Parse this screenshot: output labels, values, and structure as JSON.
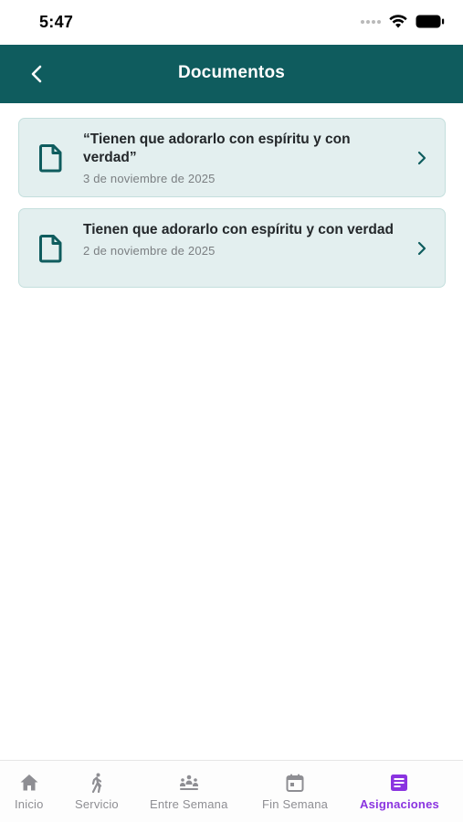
{
  "status_bar": {
    "time": "5:47"
  },
  "header": {
    "title": "Documentos"
  },
  "documents": [
    {
      "title": "“Tienen que adorarlo con espíritu y con verdad”",
      "date": "3 de noviembre de 2025"
    },
    {
      "title": "Tienen que adorarlo con espíritu y con verdad",
      "date": "2 de noviembre de 2025"
    }
  ],
  "tab_bar": {
    "active": "Asignaciones",
    "tabs": [
      {
        "label": "Inicio",
        "icon": "home-icon"
      },
      {
        "label": "Servicio",
        "icon": "walking-person-icon"
      },
      {
        "label": "Entre Semana",
        "icon": "people-group-icon"
      },
      {
        "label": "Fin Semana",
        "icon": "calendar-icon"
      },
      {
        "label": "Asignaciones",
        "icon": "assignments-icon"
      }
    ]
  },
  "colors": {
    "header_bg": "#0f5c5e",
    "card_bg": "#e3efef",
    "icon_teal": "#0f5c5e",
    "tab_active": "#8a33e0",
    "tab_inactive": "#8e8e93"
  }
}
